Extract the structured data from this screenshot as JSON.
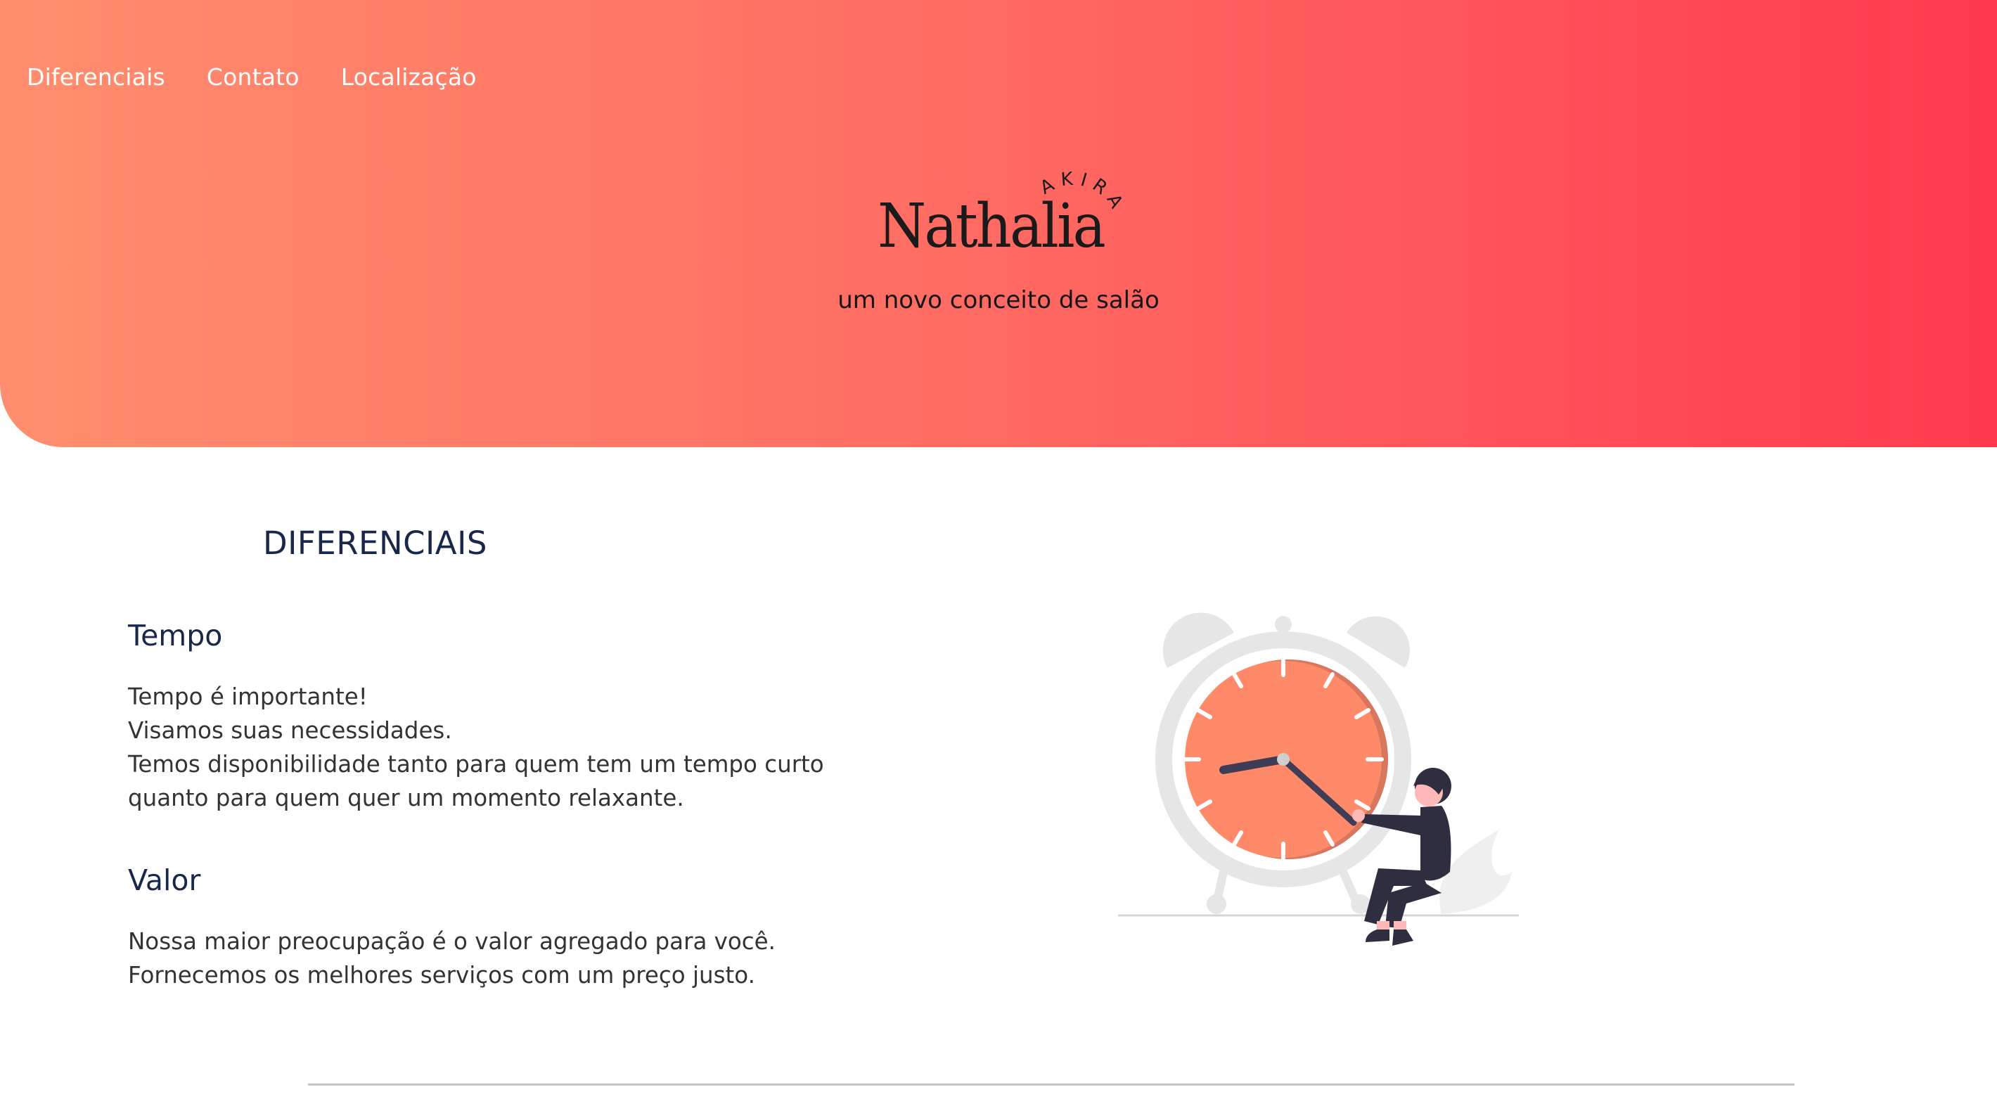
{
  "nav": {
    "items": [
      {
        "label": "Diferenciais"
      },
      {
        "label": "Contato"
      },
      {
        "label": "Localização"
      }
    ]
  },
  "brand": {
    "name": "Nathalia",
    "sub": "AKIRA",
    "tagline": "um novo conceito de salão"
  },
  "diferenciais": {
    "title": "DIFERENCIAIS",
    "items": [
      {
        "title": "Tempo",
        "lines": [
          "Tempo é importante!",
          "Visamos suas necessidades.",
          "Temos disponibilidade tanto para quem tem um tempo curto",
          "quanto para quem quer um momento relaxante."
        ]
      },
      {
        "title": "Valor",
        "lines": [
          "Nossa maior preocupação é o valor agregado para você.",
          "Fornecemos os melhores serviços com um preço justo."
        ]
      }
    ]
  },
  "colors": {
    "gradient_start": "#ff8e6e",
    "gradient_end": "#ff3a4f",
    "heading": "#182848",
    "clock_face": "#ff8a6a"
  },
  "icons": {
    "illustration": "woman-turning-clock-illustration"
  }
}
